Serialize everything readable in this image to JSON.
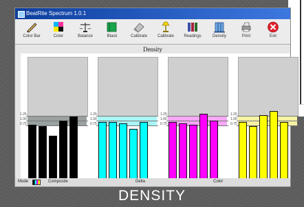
{
  "window": {
    "title": "BeatRite Spectrum 1.0.1"
  },
  "toolbar": {
    "tools": [
      {
        "label": "Color Bar",
        "icon": "pen-icon"
      },
      {
        "label": "Color",
        "icon": "color-grid-icon"
      },
      {
        "label": "Balance",
        "icon": "scale-icon"
      },
      {
        "label": "Black",
        "icon": "book-icon"
      },
      {
        "label": "Calibrate",
        "icon": "eraser-icon"
      },
      {
        "label": "Calibrate",
        "icon": "lamp-icon"
      },
      {
        "label": "Readings",
        "icon": "books-icon"
      },
      {
        "label": "Density",
        "icon": "building-icon"
      },
      {
        "label": "Print",
        "icon": "printer-icon"
      },
      {
        "label": "Exit",
        "icon": "exit-icon"
      }
    ]
  },
  "page": {
    "title": "Density"
  },
  "panels": [
    {
      "name": "black",
      "color": "#000000",
      "band_color": "#9aa0a0",
      "values": [
        0.86,
        0.84,
        0.7,
        0.92,
        0.98
      ],
      "ticks": [
        "1.25",
        "1.00",
        "0.75"
      ]
    },
    {
      "name": "cyan",
      "color": "#00ffff",
      "band_color": "#a9f5f5",
      "values": [
        0.9,
        0.9,
        0.88,
        0.8,
        0.9
      ],
      "ticks": [
        "1.25",
        "1.00",
        "0.75"
      ]
    },
    {
      "name": "magenta",
      "color": "#ff00ff",
      "band_color": "#f6a8f6",
      "values": [
        0.9,
        0.88,
        0.86,
        1.02,
        0.92
      ],
      "ticks": [
        "1.25",
        "1.00",
        "0.75"
      ]
    },
    {
      "name": "yellow",
      "color": "#ffff00",
      "band_color": "#f6f2a4",
      "values": [
        0.9,
        0.84,
        1.0,
        1.06,
        0.9
      ],
      "ticks": [
        "1.25",
        "1.00",
        "0.75"
      ]
    }
  ],
  "status": {
    "mode_label": "Mode",
    "mode_name": "Composite",
    "label_2": "Delta",
    "label_3": "Color"
  },
  "caption": "DENSITY"
}
